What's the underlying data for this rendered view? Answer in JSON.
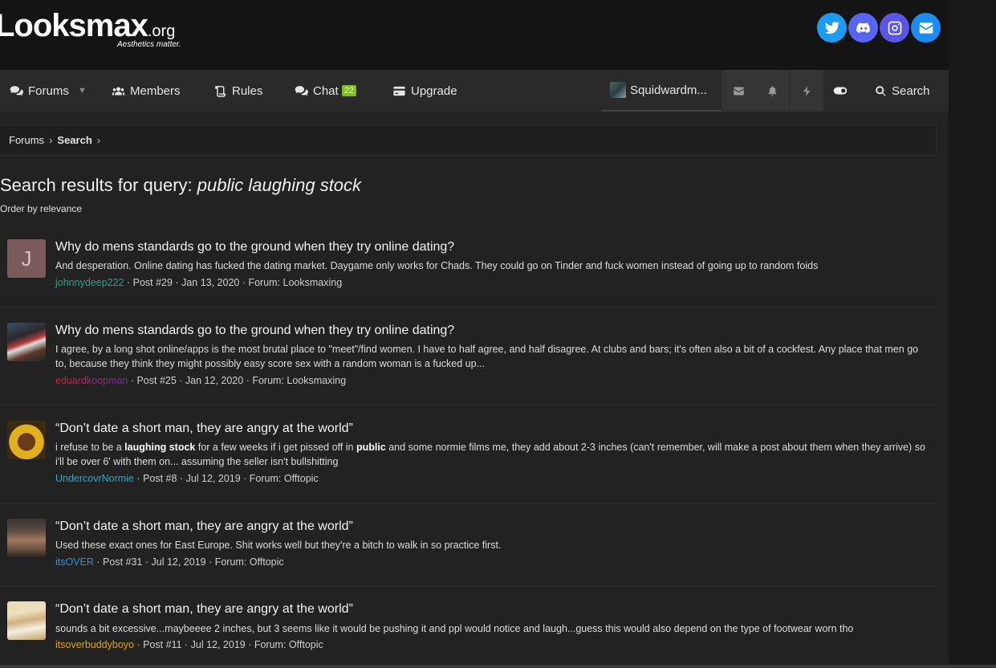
{
  "header": {
    "logo_main": "Looksmax",
    "logo_tld": ".org",
    "tagline": "Aesthetics matter.",
    "social": [
      {
        "name": "twitter-icon",
        "color": "#1d9bf0"
      },
      {
        "name": "discord-icon",
        "color": "#5865f2"
      },
      {
        "name": "instagram-icon",
        "color": "#5b55e6"
      },
      {
        "name": "email-icon",
        "color": "#1d8cf0"
      }
    ]
  },
  "nav": {
    "forums": "Forums",
    "members": "Members",
    "rules": "Rules",
    "chat": "Chat",
    "chat_count": "22",
    "upgrade": "Upgrade",
    "username": "Squidwardm...",
    "search": "Search"
  },
  "breadcrumb": {
    "forums": "Forums",
    "search": "Search"
  },
  "page": {
    "title_prefix": "Search results for query:",
    "query": "public laughing stock",
    "order": "Order by relevance"
  },
  "results": [
    {
      "title": "Why do mens standards go to the ground when they try online dating?",
      "snippet": "And desperation. Online dating has fucked the dating market. Daygame only works for Chads. They could go on Tinder and fuck women instead of going up to random foids",
      "author": "johnnydeep222",
      "author_color": "#2e9e8a",
      "post": "Post #29",
      "date": "Jan 13, 2020",
      "forum": "Forum: Looksmaxing",
      "avatar_letter": "J"
    },
    {
      "title": "Why do mens standards go to the ground when they try online dating?",
      "snippet": "I agree, by a long shot online/apps is the most brutal place to \"meet\"/find women. I have to half agree, and half disagree. At clubs and bars; it's often also a bit of a cockfest. Any place that men go to, because they think they might possibly easy score sex with a random woman is a fucked up...",
      "author": "eduardkoopman",
      "author_color": "#c0396b",
      "post": "Post #25",
      "date": "Jan 12, 2020",
      "forum": "Forum: Looksmaxing"
    },
    {
      "title": "“Don’t date a short man, they are angry at the world”",
      "snippet_parts": [
        "i refuse to be a ",
        "laughing stock",
        " for a few weeks if i get pissed off in ",
        "public",
        " and some normie films me, they add about 2-3 inches (can't remember, will make a post about them when they arrive) so i'll be over 6' with them on... assuming the seller isn't bullshitting"
      ],
      "author": "UndercovrNormie",
      "author_color": "#27a9c9",
      "post": "Post #8",
      "date": "Jul 12, 2019",
      "forum": "Forum: Offtopic"
    },
    {
      "title": "“Don’t date a short man, they are angry at the world”",
      "snippet": "Used these exact ones for East Europe. Shit works well but they're a bitch to walk in so practice first.",
      "author": "itsOVER",
      "author_color": "#2f8fd8",
      "post": "Post #31",
      "date": "Jul 12, 2019",
      "forum": "Forum: Offtopic"
    },
    {
      "title": "“Don’t date a short man, they are angry at the world”",
      "snippet": "sounds a bit excessive...maybeeee 2 inches, but 3 seems like it would be pushing it and ppl would notice and laugh...guess this would also depend on the type of footwear worn tho",
      "author": "itsoverbuddyboyo",
      "author_color": "#d9a320",
      "post": "Post #11",
      "date": "Jul 12, 2019",
      "forum": "Forum: Offtopic"
    }
  ]
}
